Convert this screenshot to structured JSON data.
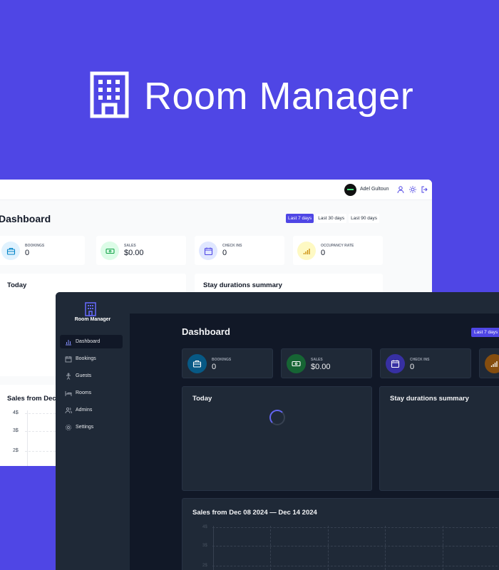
{
  "brand": {
    "title": "Room Manager",
    "icon": "building-icon",
    "accent": "#4f46e5"
  },
  "light": {
    "user_name": "Adel Gultoun",
    "page_title": "Dashboard",
    "filters": [
      "Last 7 days",
      "Last 30 days",
      "Last 90 days"
    ],
    "active_filter": "Last 7 days",
    "stats": [
      {
        "label": "BOOKINGS",
        "value": "0",
        "icon": "briefcase-icon",
        "color": "#0284c7"
      },
      {
        "label": "SALES",
        "value": "$0.00",
        "icon": "banknote-icon",
        "color": "#16a34a"
      },
      {
        "label": "CHECK INS",
        "value": "0",
        "icon": "calendar-icon",
        "color": "#4f46e5"
      },
      {
        "label": "OCCUPANCY RATE",
        "value": "0",
        "icon": "chart-bars-icon",
        "color": "#ca8a04"
      }
    ],
    "panels": {
      "today": "Today",
      "stay": "Stay durations summary",
      "sales": "Sales from Dec"
    },
    "y_ticks": [
      "4$",
      "3$",
      "2$"
    ]
  },
  "dark": {
    "brand": "Room Manager",
    "nav": [
      {
        "label": "Dashboard",
        "icon": "chart-bars-icon",
        "active": true
      },
      {
        "label": "Bookings",
        "icon": "calendar-icon",
        "active": false
      },
      {
        "label": "Guests",
        "icon": "person-icon",
        "active": false
      },
      {
        "label": "Rooms",
        "icon": "bed-icon",
        "active": false
      },
      {
        "label": "Admins",
        "icon": "users-icon",
        "active": false
      },
      {
        "label": "Settings",
        "icon": "gear-icon",
        "active": false
      }
    ],
    "page_title": "Dashboard",
    "active_filter": "Last 7 days",
    "stats": [
      {
        "label": "BOOKINGS",
        "value": "0",
        "icon": "briefcase-icon",
        "color": "#075985"
      },
      {
        "label": "SALES",
        "value": "$0.00",
        "icon": "banknote-icon",
        "color": "#166534"
      },
      {
        "label": "CHECK INS",
        "value": "0",
        "icon": "calendar-icon",
        "color": "#3730a3"
      }
    ],
    "panels": {
      "today": "Today",
      "stay": "Stay durations summary",
      "sales": "Sales from Dec 08 2024 — Dec 14 2024"
    },
    "y_ticks": [
      "4$",
      "3$",
      "2$"
    ]
  }
}
